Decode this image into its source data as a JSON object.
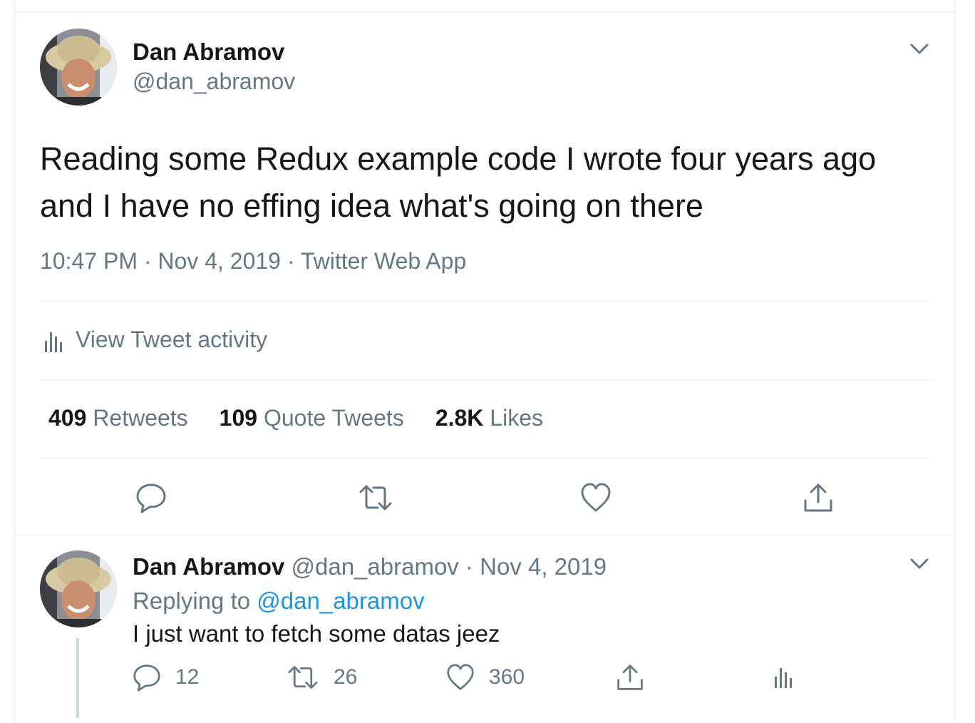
{
  "tweet": {
    "author_name": "Dan Abramov",
    "author_handle": "@dan_abramov",
    "text": "Reading some Redux example code I wrote four years ago and I have no effing idea what's going on there",
    "time": "10:47 PM",
    "date": "Nov 4, 2019",
    "source": "Twitter Web App",
    "separator": "·",
    "activity_label": "View Tweet activity",
    "stats": {
      "retweets_count": "409",
      "retweets_label": "Retweets",
      "quotes_count": "109",
      "quotes_label": "Quote Tweets",
      "likes_count": "2.8K",
      "likes_label": "Likes"
    }
  },
  "reply": {
    "author_name": "Dan Abramov",
    "author_handle": "@dan_abramov",
    "separator": "·",
    "date": "Nov 4, 2019",
    "replying_prefix": "Replying to",
    "replying_handle": "@dan_abramov",
    "text": "I just want to fetch some datas jeez",
    "reply_count": "12",
    "retweet_count": "26",
    "like_count": "360"
  },
  "colors": {
    "text": "#14171a",
    "secondary": "#657786",
    "link": "#1b95e0",
    "border": "#e6ecf0"
  }
}
